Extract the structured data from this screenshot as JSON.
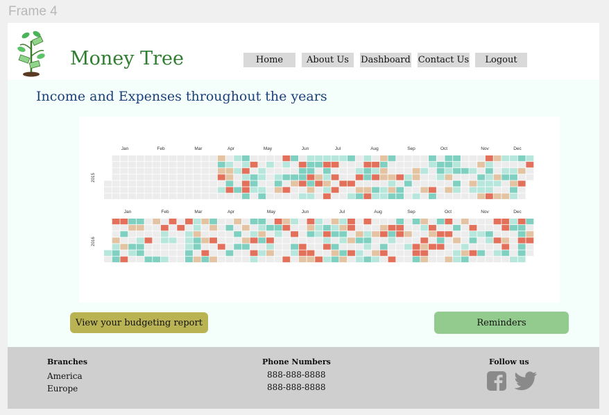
{
  "frame_label": "Frame 4",
  "brand": {
    "name": "Money Tree",
    "logo_icon": "money-tree-icon"
  },
  "nav": {
    "items": [
      {
        "label": "Home"
      },
      {
        "label": "About Us"
      },
      {
        "label": "Dashboard"
      },
      {
        "label": "Contact Us"
      },
      {
        "label": "Logout"
      }
    ]
  },
  "main": {
    "title": "Income and Expenses throughout the years"
  },
  "calendar": {
    "colors": {
      "empty": "#ececec",
      "green": "#7fd0c0",
      "light_green": "#b6e6dc",
      "tan": "#e3c3a2",
      "red": "#e2705b"
    },
    "years": [
      {
        "label": "2015",
        "months": [
          "Jan",
          "Feb",
          "Mar",
          "Apr",
          "May",
          "Jun",
          "Jul",
          "Aug",
          "Sep",
          "Oct",
          "Nov",
          "Dec"
        ]
      },
      {
        "label": "2016",
        "months": [
          "Jan",
          "Feb",
          "Mar",
          "Apr",
          "May",
          "Jun",
          "Jul",
          "Aug",
          "Sep",
          "Oct",
          "Nov",
          "Dec"
        ]
      }
    ]
  },
  "buttons": {
    "report": "View your budgeting report",
    "reminders": "Reminders"
  },
  "footer": {
    "branches": {
      "heading": "Branches",
      "items": [
        "America",
        "Europe"
      ]
    },
    "phones": {
      "heading": "Phone Numbers",
      "items": [
        "888-888-8888",
        "888-888-8888"
      ]
    },
    "follow": {
      "heading": "Follow us",
      "icons": [
        "facebook-icon",
        "twitter-icon"
      ]
    }
  }
}
